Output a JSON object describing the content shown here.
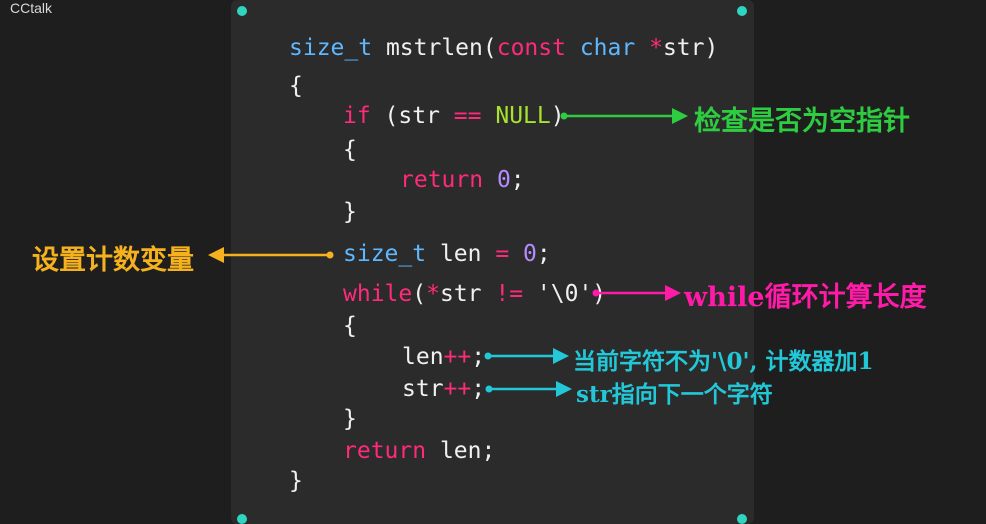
{
  "watermark": "CCtalk",
  "colors": {
    "background": "#1e1e1e",
    "panel": "#2b2b2b",
    "corner_dot": "#2ed6c2",
    "type": "#5fb8ff",
    "keyword": "#ff2a7a",
    "null": "#a6e22e",
    "number": "#b48cff",
    "text": "#f0f0f0",
    "green_annotation": "#2ecc40",
    "orange_annotation": "#f5b21e",
    "magenta_annotation": "#ff1aa8",
    "cyan_annotation": "#22c8d8"
  },
  "code": {
    "l1_type": "size_t",
    "l1_name": " mstrlen",
    "l1_paren": "(",
    "l1_const": "const",
    "l1_char": " char",
    "l1_star": " *",
    "l1_str": "str)",
    "l2": "{",
    "l3_if": "if",
    "l3_a": " (str ",
    "l3_eq": "==",
    "l3_null": " NULL",
    "l3_b": ")",
    "l4": "{",
    "l5_return": "return",
    "l5_zero": " 0",
    "l5_semi": ";",
    "l6": "}",
    "l7_type": "size_t",
    "l7_a": " len ",
    "l7_eq": "=",
    "l7_zero": " 0",
    "l7_semi": ";",
    "l8_while": "while",
    "l8_a": "(",
    "l8_star": "*",
    "l8_b": "str ",
    "l8_ne": "!=",
    "l8_c": " '\\0')",
    "l9": "{",
    "l10_a": "len",
    "l10_op": "++",
    "l10_semi": ";",
    "l11_a": "str",
    "l11_op": "++",
    "l11_semi": ";",
    "l12": "}",
    "l13_return": "return",
    "l13_a": " len;",
    "l14": "}"
  },
  "annotations": {
    "null_check": "检查是否为空指针",
    "set_counter": "设置计数变量",
    "while_loop": "while循环计算长度",
    "len_inc": "当前字符不为'\\0', 计数器加1",
    "str_inc": "str指向下一个字符"
  }
}
